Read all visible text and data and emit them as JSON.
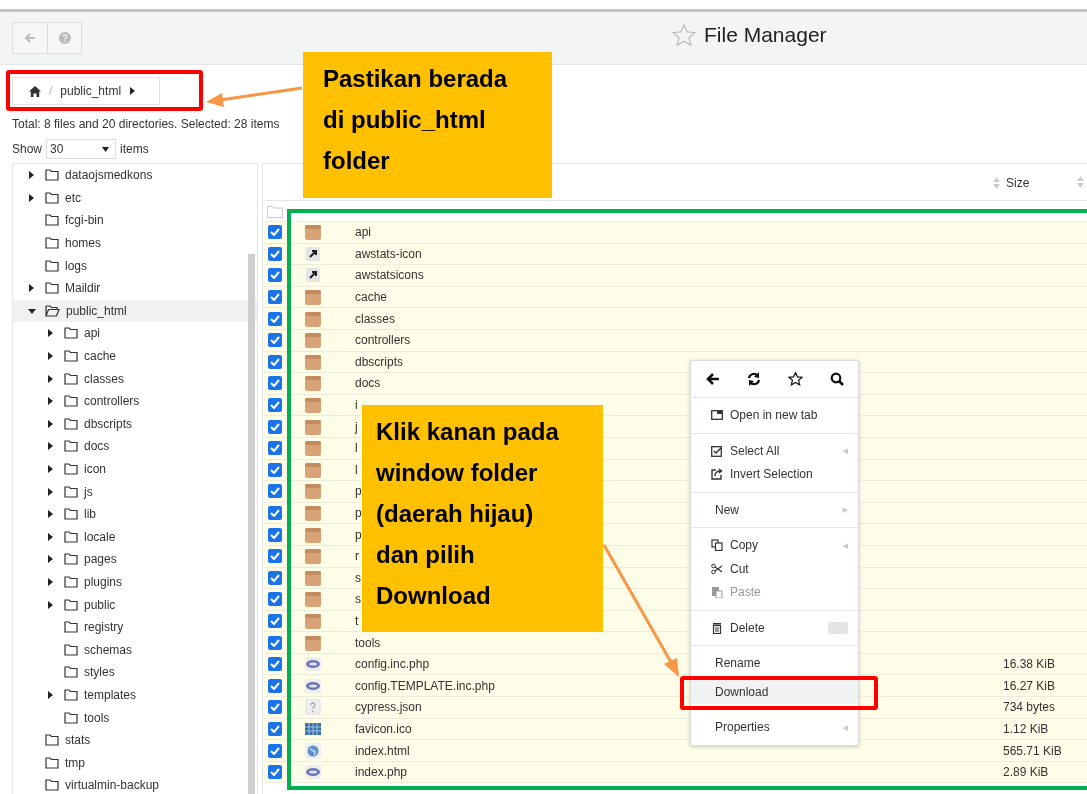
{
  "header": {
    "title": "File Manager"
  },
  "breadcrumb": {
    "separator": "/",
    "current": "public_html"
  },
  "summary": "Total: 8 files and 20 directories. Selected: 28 items",
  "page_size": {
    "label": "Show",
    "value": "30",
    "suffix": "items"
  },
  "tree": [
    {
      "name": "dataojsmedkons",
      "kind": "branch",
      "expanded": false,
      "selected": false
    },
    {
      "name": "etc",
      "kind": "branch",
      "expanded": false,
      "selected": false
    },
    {
      "name": "fcgi-bin",
      "kind": "leaf",
      "selected": false
    },
    {
      "name": "homes",
      "kind": "leaf",
      "selected": false
    },
    {
      "name": "logs",
      "kind": "leaf",
      "selected": false
    },
    {
      "name": "Maildir",
      "kind": "branch",
      "expanded": false,
      "selected": false
    },
    {
      "name": "public_html",
      "kind": "branch",
      "expanded": true,
      "selected": true,
      "children": [
        {
          "name": "api",
          "kind": "branch",
          "expanded": false,
          "selected": false
        },
        {
          "name": "cache",
          "kind": "branch",
          "expanded": false,
          "selected": false
        },
        {
          "name": "classes",
          "kind": "branch",
          "expanded": false,
          "selected": false
        },
        {
          "name": "controllers",
          "kind": "branch",
          "expanded": false,
          "selected": false
        },
        {
          "name": "dbscripts",
          "kind": "branch",
          "expanded": false,
          "selected": false
        },
        {
          "name": "docs",
          "kind": "branch",
          "expanded": false,
          "selected": false
        },
        {
          "name": "icon",
          "kind": "branch",
          "expanded": false,
          "selected": false
        },
        {
          "name": "js",
          "kind": "branch",
          "expanded": false,
          "selected": false
        },
        {
          "name": "lib",
          "kind": "branch",
          "expanded": false,
          "selected": false
        },
        {
          "name": "locale",
          "kind": "branch",
          "expanded": false,
          "selected": false
        },
        {
          "name": "pages",
          "kind": "branch",
          "expanded": false,
          "selected": false
        },
        {
          "name": "plugins",
          "kind": "branch",
          "expanded": false,
          "selected": false
        },
        {
          "name": "public",
          "kind": "branch",
          "expanded": false,
          "selected": false
        },
        {
          "name": "registry",
          "kind": "leaf",
          "selected": false
        },
        {
          "name": "schemas",
          "kind": "leaf",
          "selected": false
        },
        {
          "name": "styles",
          "kind": "leaf",
          "selected": false
        },
        {
          "name": "templates",
          "kind": "branch",
          "expanded": false,
          "selected": false
        },
        {
          "name": "tools",
          "kind": "leaf",
          "selected": false
        }
      ]
    },
    {
      "name": "stats",
      "kind": "leaf",
      "selected": false
    },
    {
      "name": "tmp",
      "kind": "leaf",
      "selected": false
    },
    {
      "name": "virtualmin-backup",
      "kind": "leaf",
      "selected": false
    }
  ],
  "table": {
    "size_header": "Size"
  },
  "files": [
    {
      "name": "api",
      "kind": "folder",
      "checked": true
    },
    {
      "name": "awstats-icon",
      "kind": "link",
      "checked": true
    },
    {
      "name": "awstatsicons",
      "kind": "link",
      "checked": true
    },
    {
      "name": "cache",
      "kind": "folder",
      "checked": true
    },
    {
      "name": "classes",
      "kind": "folder",
      "checked": true
    },
    {
      "name": "controllers",
      "kind": "folder",
      "checked": true
    },
    {
      "name": "dbscripts",
      "kind": "folder",
      "checked": true
    },
    {
      "name": "docs",
      "kind": "folder",
      "checked": true
    },
    {
      "name": "i",
      "kind": "folder",
      "checked": true
    },
    {
      "name": "j",
      "kind": "folder",
      "checked": true
    },
    {
      "name": "l",
      "kind": "folder",
      "checked": true
    },
    {
      "name": "l",
      "kind": "folder",
      "checked": true
    },
    {
      "name": "p",
      "kind": "folder",
      "checked": true
    },
    {
      "name": "p",
      "kind": "folder",
      "checked": true
    },
    {
      "name": "p",
      "kind": "folder",
      "checked": true
    },
    {
      "name": "r",
      "kind": "folder",
      "checked": true
    },
    {
      "name": "s",
      "kind": "folder",
      "checked": true
    },
    {
      "name": "s",
      "kind": "folder",
      "checked": true
    },
    {
      "name": "t",
      "kind": "folder",
      "checked": true
    },
    {
      "name": "tools",
      "kind": "folder",
      "checked": true
    },
    {
      "name": "config.inc.php",
      "kind": "php",
      "size": "16.38 KiB",
      "checked": true
    },
    {
      "name": "config.TEMPLATE.inc.php",
      "kind": "php",
      "size": "16.27 KiB",
      "checked": true
    },
    {
      "name": "cypress.json",
      "kind": "unknown",
      "size": "734 bytes",
      "checked": true
    },
    {
      "name": "favicon.ico",
      "kind": "image",
      "size": "1.12 KiB",
      "checked": true
    },
    {
      "name": "index.html",
      "kind": "web",
      "size": "565.71 KiB",
      "checked": true
    },
    {
      "name": "index.php",
      "kind": "php",
      "size": "2.89 KiB",
      "checked": true
    }
  ],
  "context_menu": {
    "groups": [
      {
        "items": [
          {
            "label": "Open in new tab",
            "kind": "open",
            "disabled": false,
            "selected": false
          }
        ]
      },
      {
        "items": [
          {
            "label": "Select All",
            "kind": "select",
            "arrow": "◂",
            "disabled": false,
            "selected": false
          },
          {
            "label": "Invert Selection",
            "kind": "invert",
            "disabled": false,
            "selected": false
          }
        ]
      },
      {
        "items": [
          {
            "label": "New",
            "kind": "plain",
            "arrow": "▸",
            "disabled": false,
            "selected": false
          }
        ]
      },
      {
        "items": [
          {
            "label": "Copy",
            "kind": "copy",
            "arrow": "◂",
            "disabled": false,
            "selected": false
          },
          {
            "label": "Cut",
            "kind": "cut",
            "disabled": false,
            "selected": false
          },
          {
            "label": "Paste",
            "kind": "paste",
            "disabled": true,
            "selected": false
          }
        ]
      },
      {
        "items": [
          {
            "label": "Delete",
            "kind": "delete",
            "shortcut": true,
            "disabled": false,
            "selected": false
          }
        ]
      },
      {
        "items": [
          {
            "label": "Rename",
            "kind": "plain",
            "disabled": false,
            "selected": false
          },
          {
            "label": "Download",
            "kind": "plain",
            "disabled": false,
            "selected": true
          }
        ]
      },
      {
        "items": [
          {
            "label": "Properties",
            "kind": "plain",
            "arrow": "◂",
            "disabled": false,
            "selected": false
          }
        ]
      }
    ]
  },
  "callouts": [
    {
      "text": "Pastikan berada\ndi public_html\nfolder"
    },
    {
      "text": "Klik kanan pada\nwindow folder\n(daerah hijau)\ndan pilih\nDownload"
    }
  ]
}
